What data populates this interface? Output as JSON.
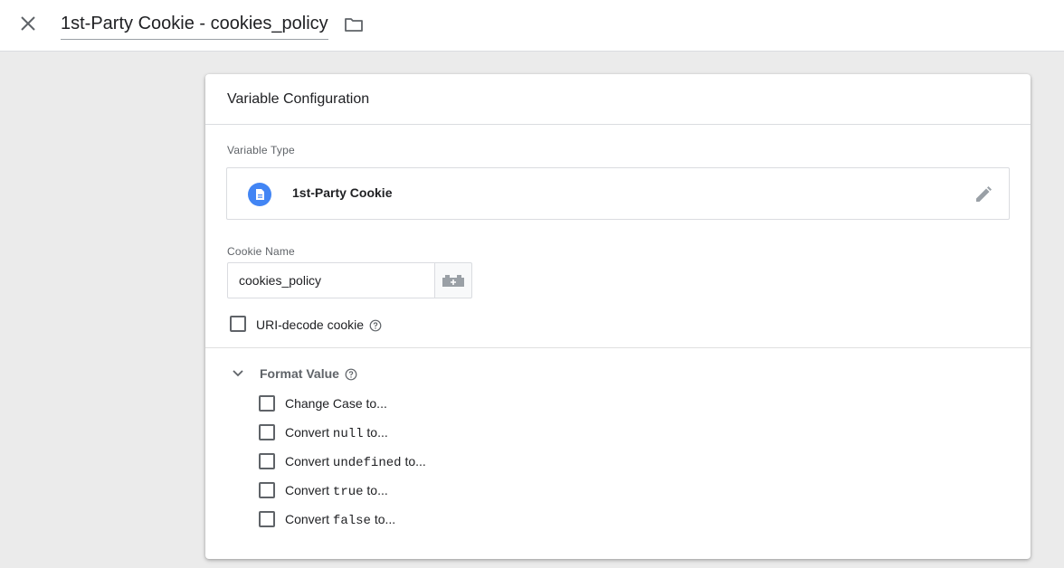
{
  "header": {
    "title": "1st-Party Cookie - cookies_policy"
  },
  "card": {
    "title": "Variable Configuration",
    "variable_type_label": "Variable Type",
    "variable_type_name": "1st-Party Cookie",
    "cookie_name_label": "Cookie Name",
    "cookie_name_value": "cookies_policy",
    "uri_decode_label": "URI-decode cookie",
    "format_value_label": "Format Value",
    "format_options": {
      "change_case": "Change Case to...",
      "convert_prefix": "Convert",
      "convert_suffix": "to...",
      "null_kw": "null",
      "undefined_kw": "undefined",
      "true_kw": "true",
      "false_kw": "false"
    }
  },
  "colors": {
    "accent": "#4285f4",
    "background": "#ebebeb",
    "text": "#202124",
    "muted": "#5f6368"
  },
  "icons": {
    "close": "close-icon",
    "folder": "folder-icon",
    "variable_type": "document-icon",
    "edit": "pencil-icon",
    "insert_variable": "lego-brick-icon",
    "help": "help-icon",
    "chevron": "chevron-down-icon"
  }
}
